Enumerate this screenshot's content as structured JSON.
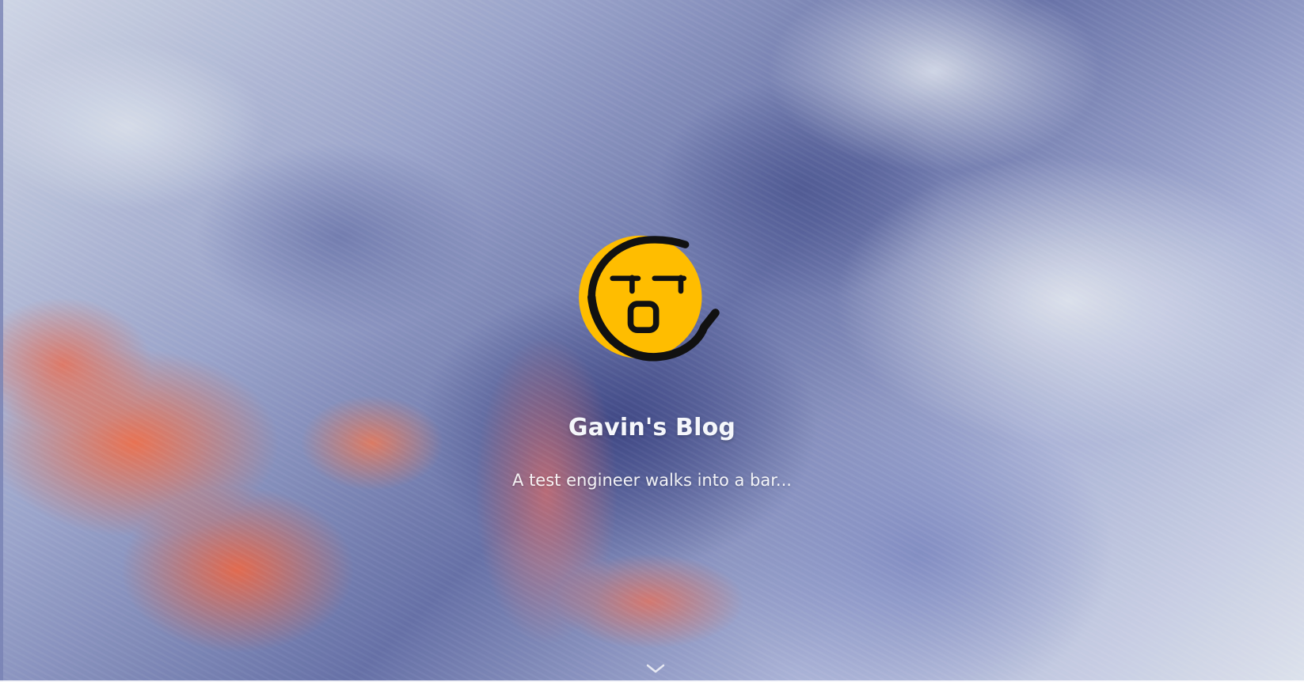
{
  "hero": {
    "title": "Gavin's Blog",
    "subtitle": "A test engineer walks into a bar..."
  },
  "icons": {
    "avatar": "yellow-face-avatar-icon",
    "scroll": "chevron-down-icon"
  },
  "colors": {
    "avatar_fill": "#FFBD00",
    "avatar_stroke": "#111111",
    "title_text": "#F5F7FB",
    "subtitle_text": "#FFFFFF",
    "accent_orange": "#FF7A50",
    "accent_blue": "#6F79B1"
  }
}
